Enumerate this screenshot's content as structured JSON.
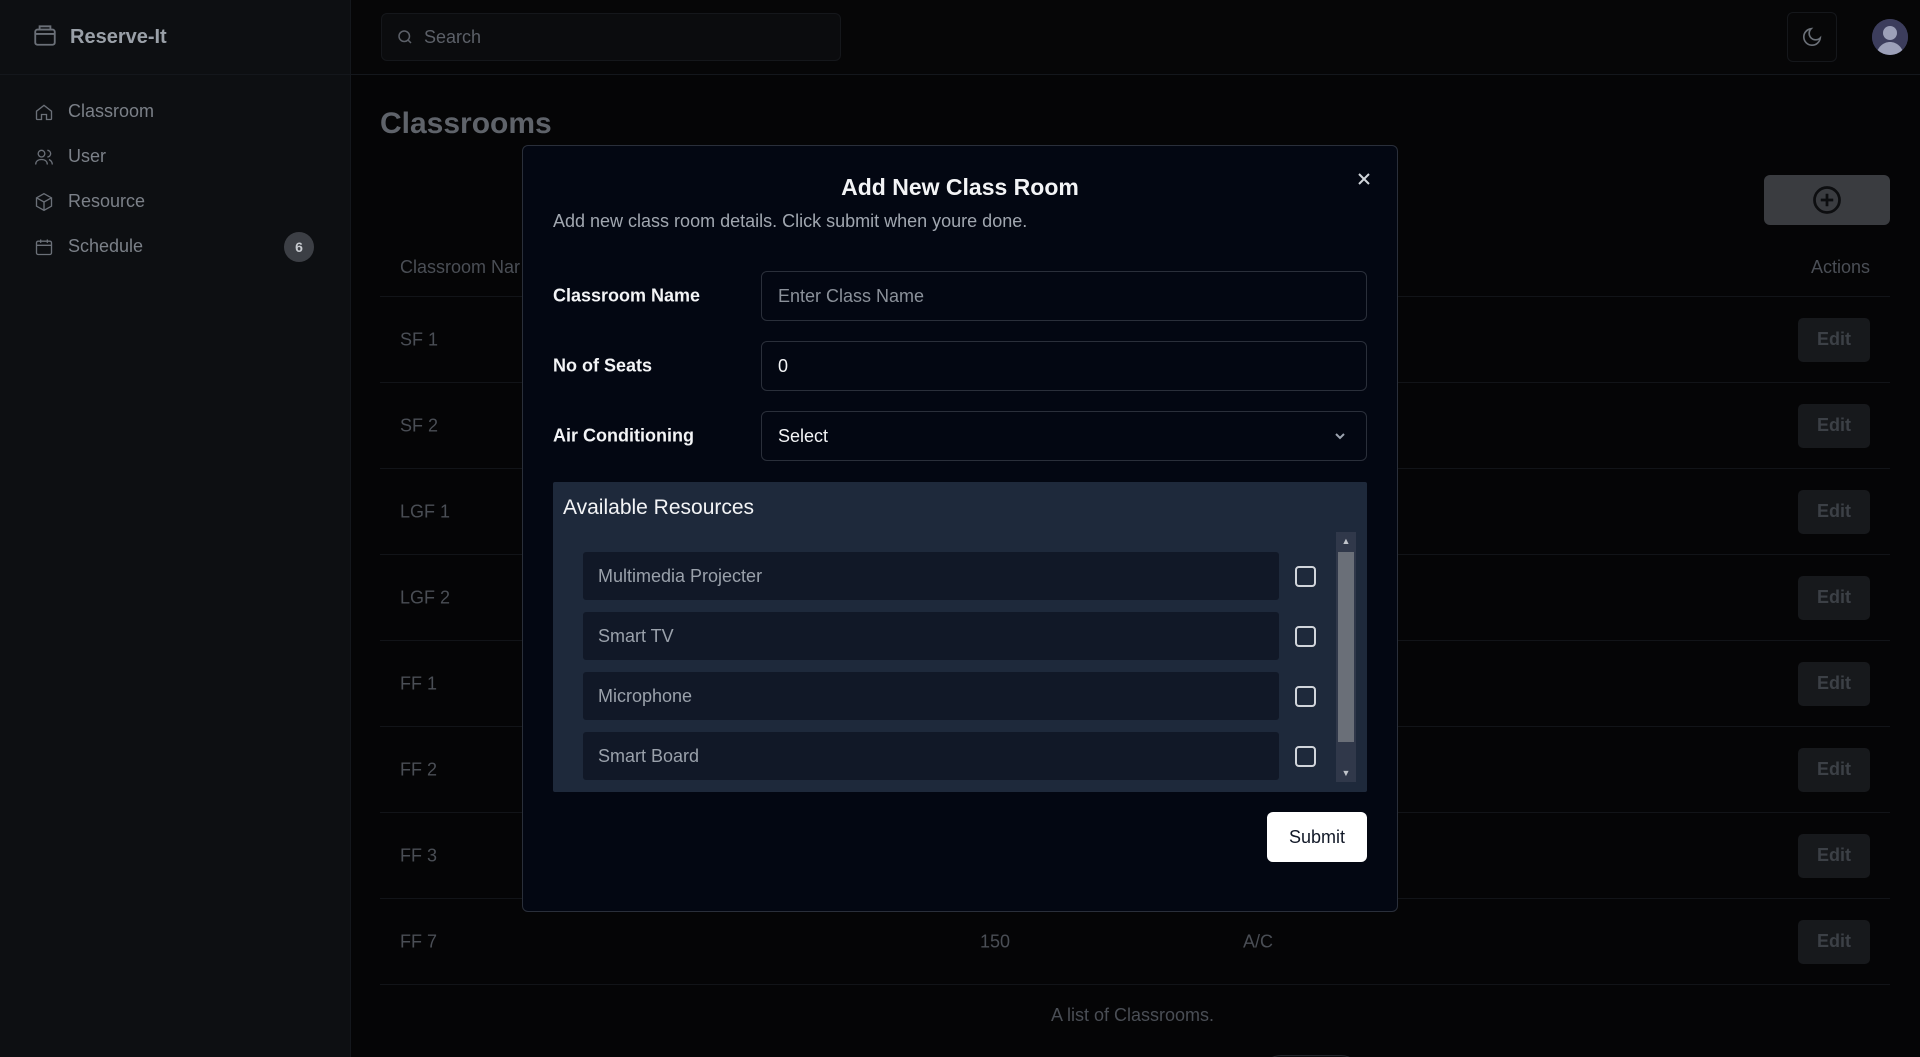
{
  "app": {
    "name": "Reserve-It"
  },
  "sidebar": {
    "items": [
      {
        "label": "Classroom",
        "icon": "home-icon"
      },
      {
        "label": "User",
        "icon": "users-icon"
      },
      {
        "label": "Resource",
        "icon": "package-icon"
      },
      {
        "label": "Schedule",
        "icon": "calendar-icon",
        "badge": "6"
      }
    ]
  },
  "header": {
    "search_placeholder": "Search"
  },
  "main": {
    "title": "Classrooms",
    "table": {
      "headers": {
        "name": "Classroom Nar",
        "actions": "Actions"
      },
      "rows": [
        {
          "name": "SF 1",
          "seats": "",
          "ac": ""
        },
        {
          "name": "SF 2",
          "seats": "",
          "ac": ""
        },
        {
          "name": "LGF 1",
          "seats": "",
          "ac": ""
        },
        {
          "name": "LGF 2",
          "seats": "",
          "ac": ""
        },
        {
          "name": "FF 1",
          "seats": "",
          "ac": ""
        },
        {
          "name": "FF 2",
          "seats": "",
          "ac": ""
        },
        {
          "name": "FF 3",
          "seats": "",
          "ac": ""
        },
        {
          "name": "FF 7",
          "seats": "150",
          "ac": "A/C"
        }
      ],
      "edit_label": "Edit",
      "caption": "A list of Classrooms."
    }
  },
  "modal": {
    "title": "Add New Class Room",
    "description": "Add new class room details. Click submit when youre done.",
    "fields": {
      "name_label": "Classroom Name",
      "name_placeholder": "Enter Class Name",
      "seats_label": "No of Seats",
      "seats_value": "0",
      "ac_label": "Air Conditioning",
      "ac_value": "Select"
    },
    "resources": {
      "title": "Available Resources",
      "items": [
        "Multimedia Projecter",
        "Smart TV",
        "Microphone",
        "Smart Board"
      ]
    },
    "submit_label": "Submit"
  },
  "colors": {
    "background": "#0a0a0b",
    "modal_bg": "#030712",
    "resources_bg": "#1e293b",
    "resource_field_bg": "#111827"
  }
}
